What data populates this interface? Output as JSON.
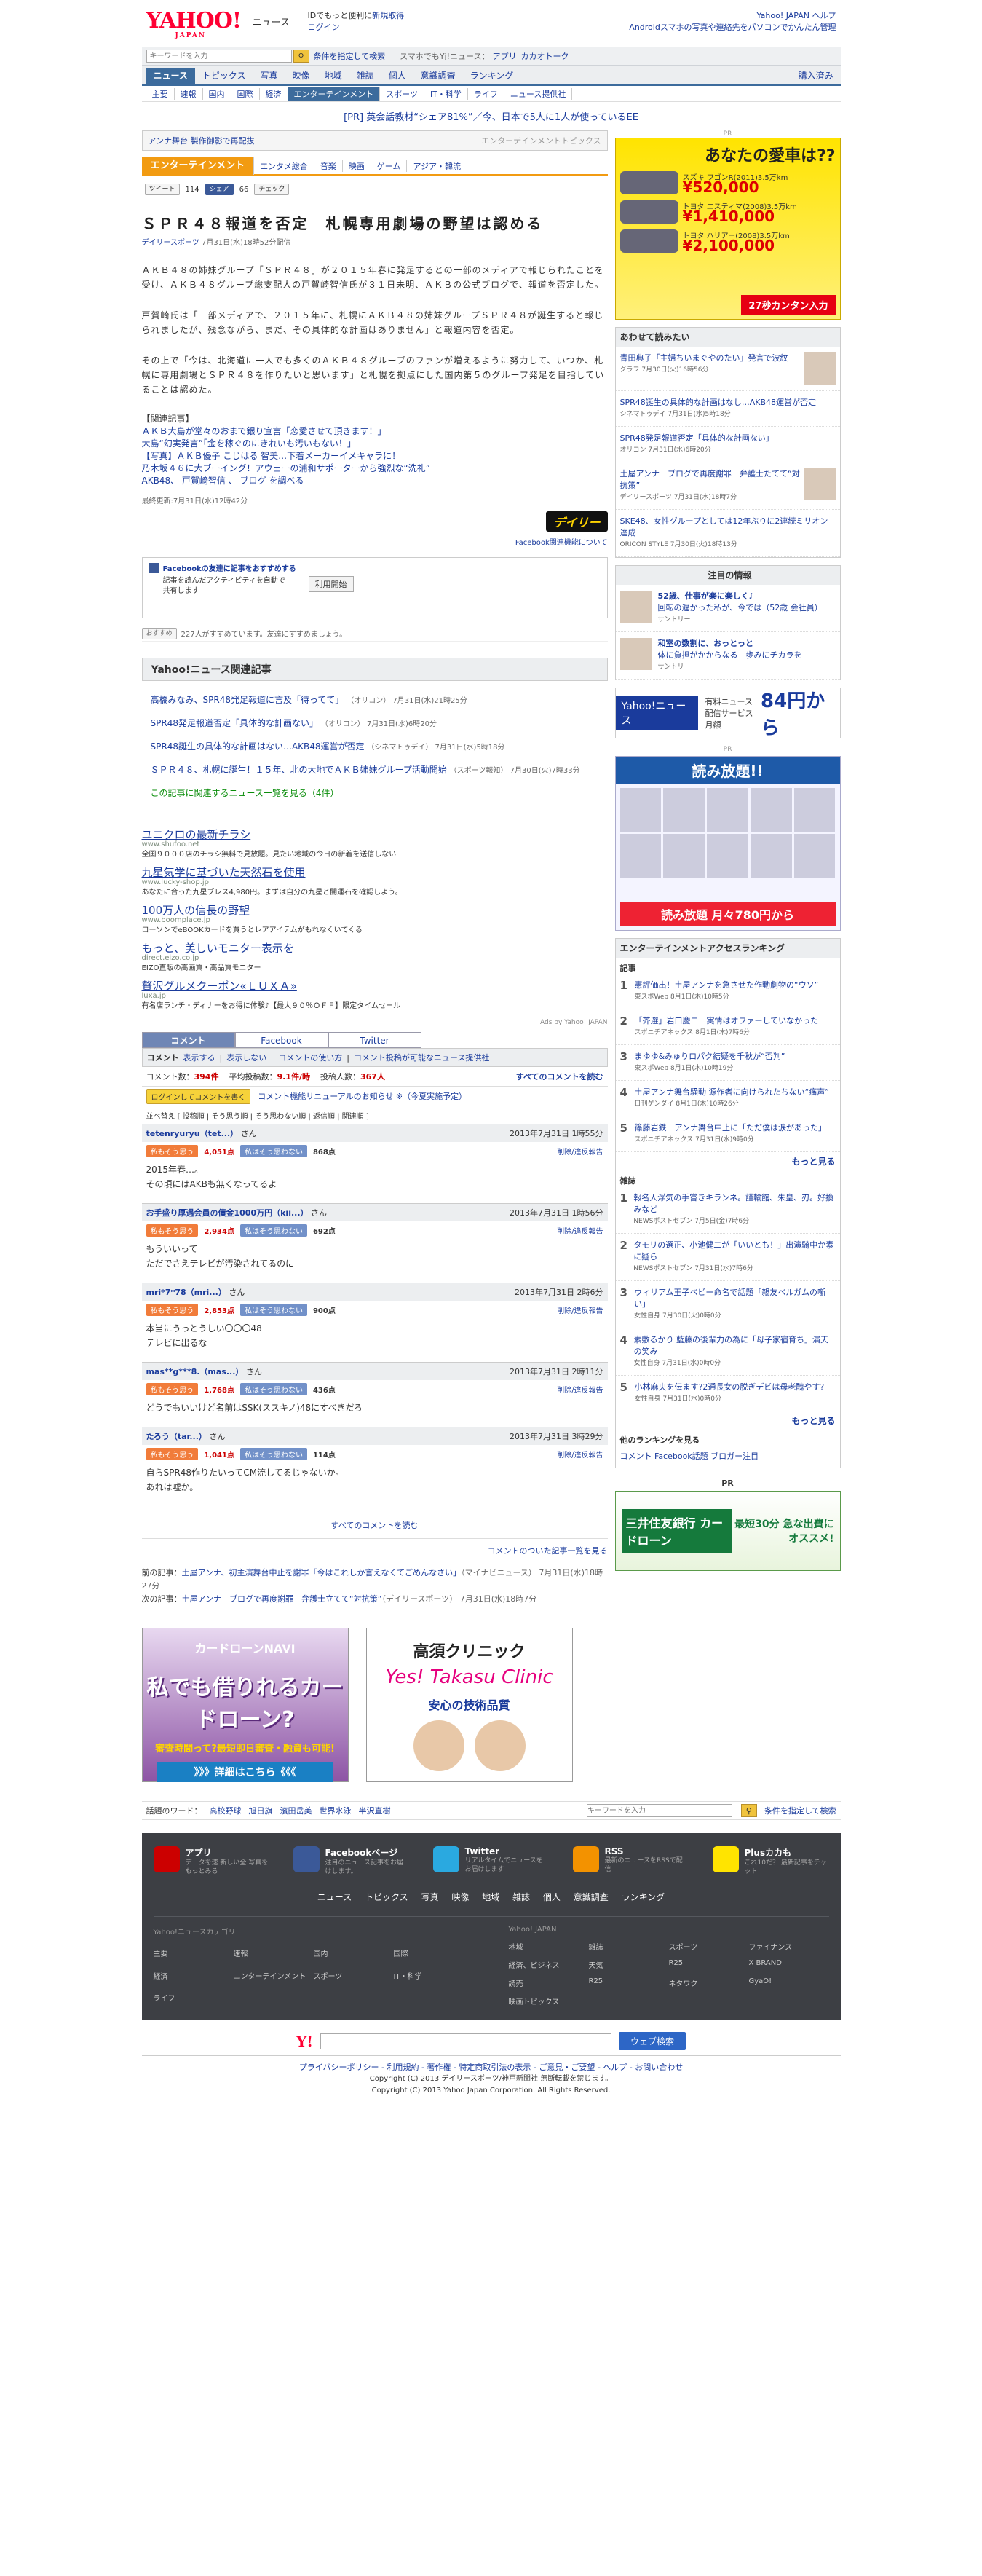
{
  "header": {
    "logo": "YAHOO!",
    "logo_sub": "JAPAN",
    "service": "ニュース",
    "promo": "IDでもっと便利に",
    "signup": "新規取得",
    "login": "ログイン",
    "yahoo_top": "Yahoo! JAPAN",
    "help": "ヘルプ",
    "android": "Androidスマホの写真や連絡先をパソコンでかんたん管理"
  },
  "search": {
    "placeholder": "キーワードを入力",
    "advanced": "条件を指定して検索",
    "mobile": "スマホでもYj!ニュース：",
    "app": "アプリ",
    "catalog": "カカオトーク"
  },
  "tabs": [
    "ニュース",
    "トピックス",
    "写真",
    "映像",
    "地域",
    "雑誌",
    "個人",
    "意識調査",
    "ランキング"
  ],
  "tabs_right": "購入済み",
  "subnav": [
    "主要",
    "速報",
    "国内",
    "国際",
    "経済",
    "エンターテインメント",
    "スポーツ",
    "IT・科学",
    "ライフ",
    "ニュース提供社"
  ],
  "prline": "[PR] 英会話教材“シェア81%”／今、日本で5人に1人が使っているEE",
  "tagbar": {
    "left": "アンナ舞台 製作御影で再配抜",
    "right": "エンターテインメントトピックス"
  },
  "category": {
    "label": "エンターテインメント",
    "items": [
      "エンタメ総合",
      "音楽",
      "映画",
      "ゲーム",
      "アジア・韓流"
    ]
  },
  "social": {
    "tweet": "ツイート",
    "tweet_count": "114",
    "share": "シェア",
    "share_count": "66",
    "check": "チェック"
  },
  "article": {
    "title": "ＳＰＲ４８報道を否定　札幌専用劇場の野望は認める",
    "source": "デイリースポーツ",
    "date": "7月31日(水)18時52分配信",
    "paragraphs": [
      "ＡＫＢ４８の姉妹グループ「ＳＰＲ４８」が２０１５年春に発足するとの一部のメディアで報じられたことを受け、ＡＫＢ４８グループ総支配人の戸賀崎智信氏が３１日未明、ＡＫＢの公式ブログで、報道を否定した。",
      "戸賀崎氏は「一部メディアで、２０１５年に、札幌にＡＫＢ４８の姉妹グループＳＰＲ４８が誕生すると報じられましたが、残念ながら、まだ、その具体的な計画はありません」と報道内容を否定。",
      "その上で「今は、北海道に一人でも多くのＡＫＢ４８グループのファンが増えるように努力して、いつか、札幌に専用劇場とＳＰＲ４８を作りたいと思います」と札幌を拠点にした国内第５のグループ発足を目指していることは認めた。"
    ],
    "related_title": "【関連記事】",
    "related": [
      "ＡＫＢ大島が堂々のおまで銀り宣言「恋愛させて頂きます！」",
      "大島“幻実発言”「金を稼ぐのにきれいも汚いもない！」",
      "【写真】ＡＫＢ優子 こじはる 智美…下着メーカーイメキャラに！",
      "乃木坂４６に大ブーイング！アウェーの浦和サポーターから強烈な“洗礼”"
    ],
    "tags_prefix": "AKB48、 戸賀崎智信 、 ブログ を調べる",
    "updated": "最終更新:7月31日(水)12時42分",
    "daily_logo": "デイリー",
    "fb_link": "Facebook関連機能について"
  },
  "fbbox": {
    "title": "Facebookの友達に記事をおすすめする",
    "body": "記事を読んだアクティビティを自動で共有します",
    "button": "利用開始"
  },
  "recommend": {
    "label": "おすすめ",
    "text": "227人がすすめています。友達にすすめましょう。"
  },
  "related_news": {
    "title": "Yahoo!ニュース関連記事",
    "items": [
      {
        "t": "高橋みなみ、SPR48発足報道に言及「待ってて」",
        "s": "（オリコン） 7月31日(水)21時25分"
      },
      {
        "t": "SPR48発足報道否定「具体的な計画ない」",
        "s": "（オリコン） 7月31日(水)6時20分"
      },
      {
        "t": "SPR48誕生の具体的な計画はない…AKB48運営が否定",
        "s": "（シネマトゥデイ） 7月31日(水)5時18分"
      },
      {
        "t": "ＳＰＲ４８、札幌に誕生！１５年、北の大地でＡＫＢ姉妹グループ活動開始",
        "s": "（スポーツ報知） 7月30日(火)7時33分"
      }
    ],
    "more": "この記事に関連するニュース一覧を見る（4件）"
  },
  "ads": [
    {
      "h": "ユニクロの最新チラシ",
      "u": "www.shufoo.net",
      "d": "全国９０００店のチラシ無料で見放題。見たい地域の今日の新着を送信しない"
    },
    {
      "h": "九星気学に基づいた天然石を使用",
      "u": "www.lucky-shop.jp",
      "d": "あなたに合った九星ブレス4,980円。まずは自分の九星と開運石を確認しよう。"
    },
    {
      "h": "100万人の信長の野望",
      "u": "www.boomplace.jp",
      "d": "ローソンでeBOOKカードを買うとレアアイテムがもれなくいてくる"
    },
    {
      "h": "もっと、美しいモニター表示を",
      "u": "direct.eizo.co.jp",
      "d": "EIZO直販の高画質・高品質モニター"
    },
    {
      "h": "贅沢グルメクーポン«ＬＵＸＡ»",
      "u": "luxa.jp",
      "d": "有名店ランチ・ディナーをお得に体験♪【最大９０％ＯＦＦ】限定タイムセール"
    }
  ],
  "ads_by": "Ads by Yahoo! JAPAN",
  "comment_tabs": [
    "コメント",
    "Facebook",
    "Twitter"
  ],
  "comments_bar": {
    "label": "コメント",
    "show": "表示する",
    "hide": "表示しない",
    "usage": "コメントの使い方",
    "ranking": "コメント投稿が可能なニュース提供社"
  },
  "stats": {
    "count_label": "コメント数：",
    "count": "394件",
    "avg_label": "平均投稿数：",
    "avg": "9.1件/時",
    "users_label": "投稿人数：",
    "users": "367人",
    "all": "すべてのコメントを読む"
  },
  "login_bar": {
    "button": "ログインしてコメントを書く",
    "note": "コメント機能リニューアルのお知らせ ※（今夏実施予定）"
  },
  "sort": "並べ替え [ 投稿順 | そう思う順 | そう思わない順 | 返信順 | 関連順 ]",
  "comments": [
    {
      "user": "tetenryuryu（tet...）",
      "san": "さん",
      "date": "2013年7月31日 1時55分",
      "good": "4,051点",
      "bad": "868点",
      "text": "2015年春…。\nその頃にはAKBも無くなってるよ"
    },
    {
      "user": "お手盛り厚遇会員の債金1000万円（kii...）",
      "san": "さん",
      "date": "2013年7月31日 1時56分",
      "good": "2,934点",
      "bad": "692点",
      "text": "もういいって\nただでさえテレビが汚染されてるのに"
    },
    {
      "user": "mri*7*78（mri...）",
      "san": "さん",
      "date": "2013年7月31日 2時6分",
      "good": "2,853点",
      "bad": "900点",
      "text": "本当にうっとうしい〇〇〇48\nテレビに出るな"
    },
    {
      "user": "mas**g***8.（mas...）",
      "san": "さん",
      "date": "2013年7月31日 2時11分",
      "good": "1,768点",
      "bad": "436点",
      "text": "どうでもいいけど名前はSSK(ススキノ)48にすべきだろ"
    },
    {
      "user": "たろう（tar...）",
      "san": "さん",
      "date": "2013年7月31日 3時29分",
      "good": "1,041点",
      "bad": "114点",
      "text": "自らSPR48作りたいってCM流してるじゃないか。\nあれは嘘か。"
    }
  ],
  "comment_vote": {
    "agree": "私もそう思う",
    "disagree": "私はそう思わない",
    "report": "削除/違反報告"
  },
  "all_comments": "すべてのコメントを読む",
  "article_list": "コメントのついた記事一覧を見る",
  "prevnext": {
    "prev_label": "前の記事：",
    "prev": "土屋アンナ、初主演舞台中止を謝罪「今はこれしか言えなくてごめんなさい」",
    "prev_src": "（マイナビニュース） 7月31日(水)18時27分",
    "next_label": "次の記事：",
    "next": "土屋アンナ　ブログで再度謝罪　弁護士立てて“対抗策”",
    "next_src": "（デイリースポーツ） 7月31日(水)18時7分"
  },
  "banner1": {
    "t1": "カードローンNAVI",
    "t2": "私でも借りれるカードローン?",
    "t3": "審査時間って?最短即日審査・融資も可能!",
    "t4": "》》》詳細はこちら《《《"
  },
  "banner2": {
    "t1": "高須クリニック",
    "t2": "Yes! Takasu Clinic",
    "t3": "安心の技術品質"
  },
  "keywords": {
    "label": "話題のワード：",
    "items": [
      "高校野球",
      "旭日旗",
      "濱田岳美",
      "世界水泳",
      "半沢直樹"
    ],
    "placeholder": "キーワードを入力",
    "advanced": "条件を指定して検索"
  },
  "sidebar": {
    "car": {
      "q": "あなたの愛車は??",
      "items": [
        {
          "n": "スズキ ワゴンR(2011)3.5万km",
          "p": "¥520,000"
        },
        {
          "n": "トヨタ エスティマ(2008)3.5万km",
          "p": "¥1,410,000"
        },
        {
          "n": "トヨタ ハリアー(2008)3.5万km",
          "p": "¥2,100,000"
        }
      ],
      "cta": "27秒カンタン入力"
    },
    "recommend_title": "あわせて読みたい",
    "recommend": [
      {
        "t": "青田典子「主婦ちいまぐやのたい」発言で波紋",
        "tm": "グラフ 7月30日(火)16時56分"
      },
      {
        "t": "SPR48誕生の具体的な計画はなし…AKB48運営が否定",
        "tm": "シネマトゥデイ 7月31日(水)5時18分"
      },
      {
        "t": "SPR48発足報道否定「具体的な計画ない」",
        "tm": "オリコン 7月31日(水)6時20分"
      },
      {
        "t": "土屋アンナ　ブログで再度謝罪　弁護士たてて“対抗策”",
        "tm": "デイリースポーツ 7月31日(水)18時7分"
      },
      {
        "t": "SKE48、女性グループとしては12年ぶりに2連続ミリオン達成",
        "tm": "ORICON STYLE 7月30日(火)18時13分"
      }
    ],
    "notice_title": "注目の情報",
    "notice": [
      {
        "t": "52歳、仕事が楽に楽しく♪",
        "d": "回転の遅かった私が、今では（52歳 会社員）",
        "s": "サントリー"
      },
      {
        "t": "和室の数割に、おっとっと",
        "d": "体に負担がかからなる　歩みにチカラを",
        "s": "サントリー"
      }
    ],
    "ynews": "Yahoo!ニュース",
    "price_label": "有料ニュース配信サービス 月額",
    "price": "84円から",
    "manga_title": "読み放題!!",
    "manga_price": "読み放題 月々780円から",
    "ranking_title": "エンターテインメントアクセスランキング",
    "ranking_sub": "記事",
    "ranking": [
      {
        "t": "憲評価出！土屋アンナを急させた作動劇物の“ウソ”",
        "tm": "東スポWeb 8月1日(木)10時5分"
      },
      {
        "t": "「芥選」岩口慶二　実情はオファーしていなかった",
        "tm": "スポニチアネックス 8月1日(木)7時6分"
      },
      {
        "t": "まゆゆ&みゅりロパク結疑を千秋が“否判”",
        "tm": "東スポWeb 8月1日(木)10時19分"
      },
      {
        "t": "土屋アンナ舞台騒動 源作者に向けられたちない“痛声”",
        "tm": "日刊ゲンダイ 8月1日(木)10時26分"
      },
      {
        "t": "篠藤岩鉄　アンナ舞台中止に「ただ僕は涙があった」",
        "tm": "スポニチアネックス 7月31日(水)9時0分"
      }
    ],
    "ranking_more": "もっと見る",
    "mag_title": "雑誌",
    "mag": [
      {
        "t": "報名人浮気の手嘗きキランネ。謹輸館、朱皇、刃。好換みなど",
        "tm": "NEWSポストセブン 7月5日(金)7時6分"
      },
      {
        "t": "タモリの選正、小池健二が「いいとも！」出演騎中か素に疑ら",
        "tm": "NEWSポストセブン 7月31日(水)7時6分"
      },
      {
        "t": "ウィリアム王子ベビー命名で話題「親友ベルガムの噺い」",
        "tm": "女性自身 7月30日(火)0時0分"
      },
      {
        "t": "素敷るかり 藍藤の後輩力の為に「母子家宿育ち」演天の笑み",
        "tm": "女性自身 7月31日(水)0時0分"
      },
      {
        "t": "小林麻央を伝ます?2通長女の脱ぎデビは母老醜やす?",
        "tm": "女性自身 7月31日(水)0時0分"
      }
    ],
    "mag_more": "もっと見る",
    "other_rank": "他のランキングを見る",
    "other_links": "コメント Facebook話題 ブロガー注目",
    "smbc": {
      "g": "三井住友銀行 カードローン",
      "d": "最短30分 急な出費にオススメ!"
    },
    "pr": "PR"
  },
  "footer": {
    "apps": [
      {
        "n": "アプリ",
        "d": "データを速 新しい全 写真をもっとみる"
      },
      {
        "n": "Facebookページ",
        "d": "注目のニュース記事をお届けします。"
      },
      {
        "n": "Twitter",
        "d": "リアルタイムでニュースをお届けします"
      },
      {
        "n": "RSS",
        "d": "最新のニュースをRSSで配信"
      },
      {
        "n": "Plusカカも",
        "d": "これ10だ？ 最新記事をチャット"
      }
    ],
    "links": [
      "ニュース",
      "トピックス",
      "写真",
      "映像",
      "地域",
      "雑誌",
      "個人",
      "意識調査",
      "ランキング"
    ],
    "cat1_title": "Yahoo!ニュースカテゴリ",
    "cat1": [
      "主要",
      "速報",
      "国内",
      "国際",
      "経済",
      "エンターテインメント",
      "スポーツ",
      "IT・科学",
      "ライフ"
    ],
    "cat2_title": "Yahoo! JAPAN",
    "cat2": [
      "地域",
      "雑誌",
      "スポーツ",
      "ファイナンス",
      "経済、ビジネス",
      "天気",
      "R25",
      "X BRAND",
      "読売",
      "R25",
      "ネタワク",
      "GyaO!",
      "映画トピックス"
    ],
    "search_button": "ウェブ検索",
    "policy": "プライバシーポリシー - 利用規約 - 著作権 - 特定商取引法の表示 - ご意見・ご要望 - ヘルプ - お問い合わせ",
    "copy1": "Copyright (C) 2013 デイリースポーツ/神戸新聞社 無断転載を禁じます。",
    "copy2": "Copyright (C) 2013 Yahoo Japan Corporation. All Rights Reserved."
  }
}
